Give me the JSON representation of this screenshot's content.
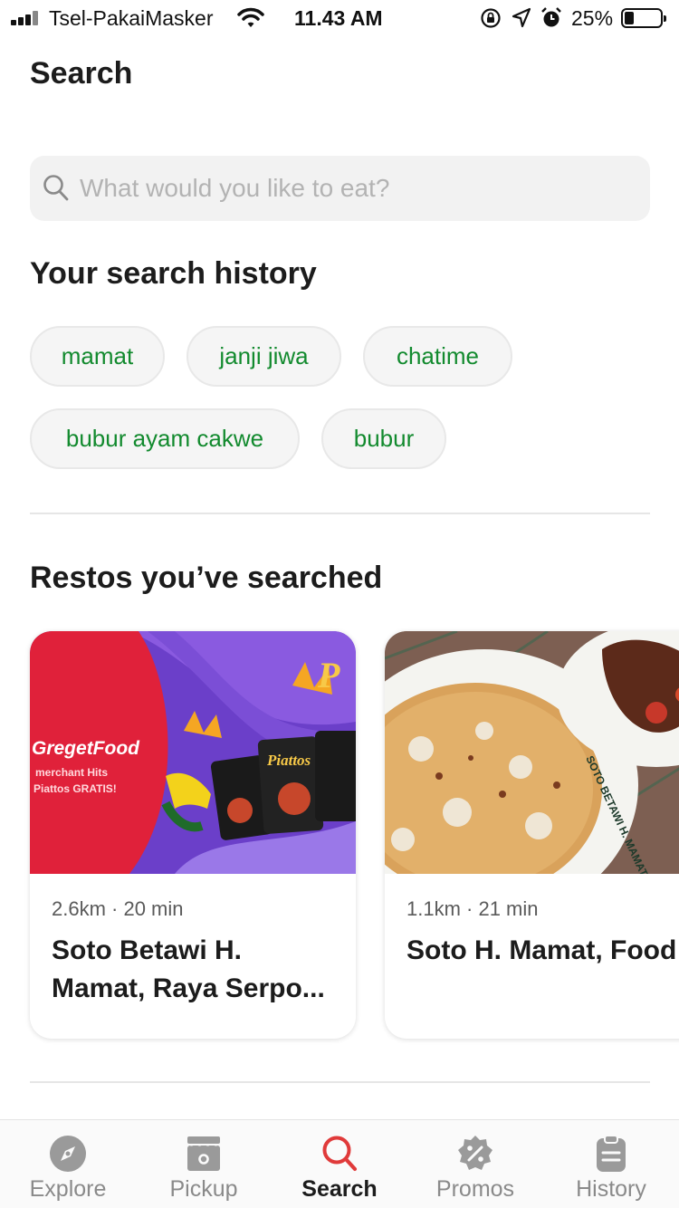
{
  "status_bar": {
    "carrier": "Tsel-PakaiMasker",
    "time": "11.43 AM",
    "battery_percent": "25%",
    "battery_level": 0.25
  },
  "page": {
    "title": "Search"
  },
  "search": {
    "placeholder": "What would you like to eat?",
    "value": ""
  },
  "history": {
    "title": "Your search history",
    "items": [
      "mamat",
      "janji jiwa",
      "chatime",
      "bubur ayam cakwe",
      "bubur"
    ]
  },
  "restos": {
    "title": "Restos you’ve searched",
    "items": [
      {
        "meta": "2.6km · 20 min",
        "name": "Soto Betawi H. Mamat, Raya Serpo...",
        "promo_line1": "GregetFood",
        "promo_line2": "merchant Hits",
        "promo_line3": "Piattos GRATIS!",
        "product_label": "Piattos"
      },
      {
        "meta": "1.1km · 21 min",
        "name": "Soto H. Mamat, Food Carnival Aeon Mall",
        "bowl_text": "SOTO BETAWI H. MAMAT"
      }
    ]
  },
  "nav": {
    "items": [
      {
        "label": "Explore",
        "icon": "compass-icon",
        "active": false
      },
      {
        "label": "Pickup",
        "icon": "pickup-store-icon",
        "active": false
      },
      {
        "label": "Search",
        "icon": "search-icon",
        "active": true
      },
      {
        "label": "Promos",
        "icon": "promo-percent-icon",
        "active": false
      },
      {
        "label": "History",
        "icon": "history-clipboard-icon",
        "active": false
      }
    ]
  },
  "colors": {
    "accent_green": "#128a2e",
    "active_red": "#e03a3a",
    "inactive_gray": "#8a8a8a"
  }
}
